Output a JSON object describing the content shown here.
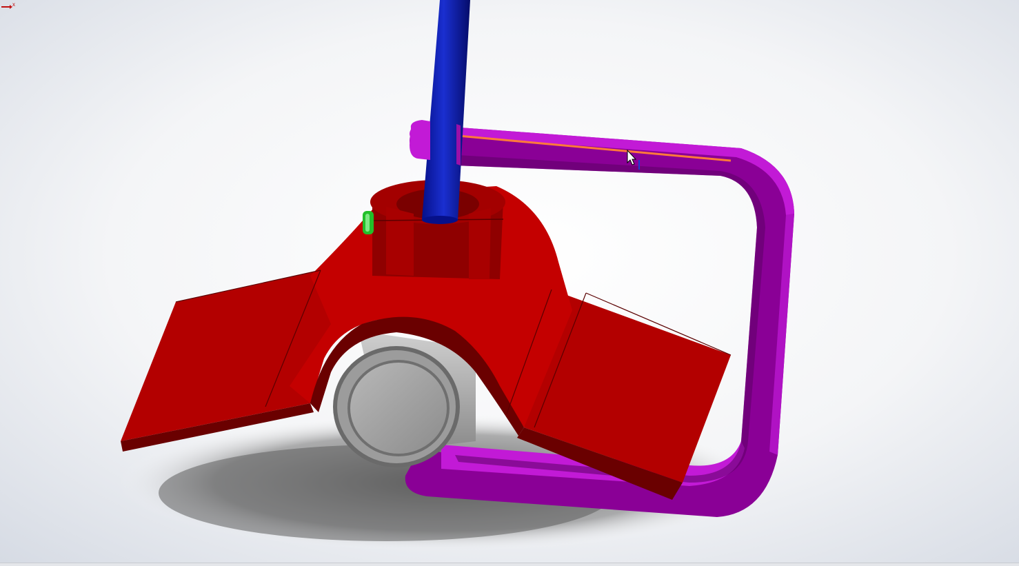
{
  "viewport": {
    "background_center": "#ffffff",
    "background_edge": "#d6dbe4"
  },
  "model": {
    "shaft": {
      "color": "#0a1aa8",
      "highlight": "#2a3de0"
    },
    "impeller": {
      "color": "#b30000",
      "dark": "#7a0000",
      "edge": "#5a0000"
    },
    "bracket": {
      "color": "#8a0096",
      "light": "#c21ad6",
      "dark": "#5c0066"
    },
    "tube": {
      "color": "#a8a8a8",
      "inner": "#8e8e8e",
      "rim": "#6a6a6a"
    },
    "selected_edge_color": "#ff7a3a",
    "mate_marker_color": "#22c02a"
  },
  "icons": {
    "cursor": "arrow-cursor-icon",
    "triad": "axis-triad-icon",
    "triad_label": "x"
  }
}
